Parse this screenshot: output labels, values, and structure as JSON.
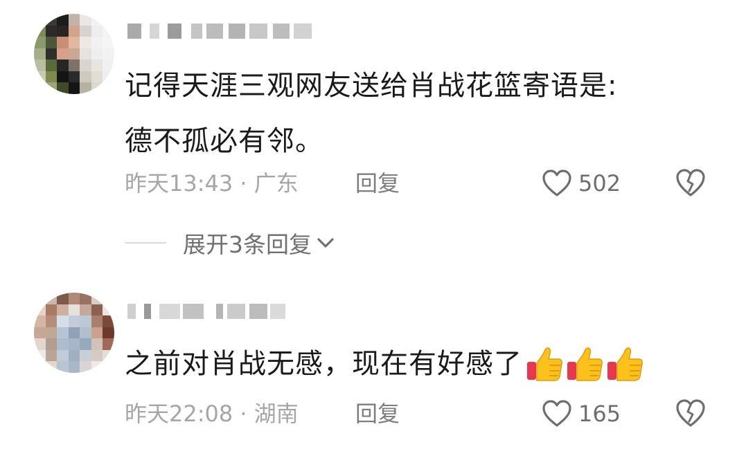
{
  "comments": [
    {
      "text": "记得天涯三观网友送给肖战花篮寄语是:\n德不孤必有邻。",
      "time_location": "昨天13:43 · 广东",
      "reply_label": "回复",
      "likes": "502",
      "expand_label": "展开3条回复"
    },
    {
      "text": "之前对肖战无感，现在有好感了",
      "emoji_count": 3,
      "time_location": "昨天22:08 · 湖南",
      "reply_label": "回复",
      "likes": "165"
    }
  ],
  "icons": {
    "like": "heart-outline-icon",
    "dislike": "broken-heart-icon",
    "expand": "chevron-down-icon",
    "emoji": "thumbs-up-emoji"
  },
  "colors": {
    "text": "#1a1a1a",
    "meta": "#a6a6a6",
    "icon": "#6e6e6e"
  }
}
